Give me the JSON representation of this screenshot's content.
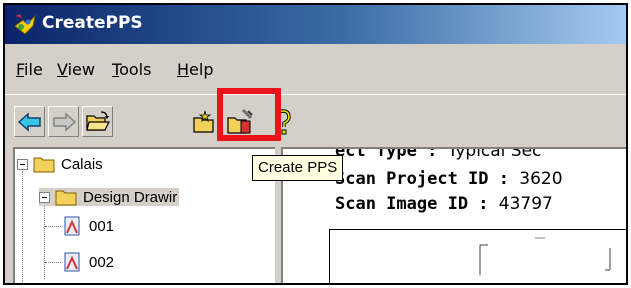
{
  "window": {
    "title": "CreatePPS"
  },
  "menu": {
    "file": {
      "mnemonic": "F",
      "rest": "ile"
    },
    "view": {
      "mnemonic": "V",
      "rest": "iew"
    },
    "tools": {
      "mnemonic": "T",
      "rest": "ools"
    },
    "help": {
      "mnemonic": "H",
      "rest": "elp"
    }
  },
  "toolbar": {
    "buttons": [
      {
        "icon": "back-arrow-icon"
      },
      {
        "icon": "forward-arrow-icon"
      },
      {
        "icon": "open-folder-icon"
      },
      {
        "icon": "new-folder-icon"
      },
      {
        "icon": "create-pps-icon"
      },
      {
        "icon": "help-icon"
      }
    ],
    "tooltip": "Create PPS"
  },
  "tree": {
    "root": "Calais",
    "folder": "Design Drawir",
    "items": [
      "001",
      "002"
    ]
  },
  "details": {
    "line1_label": "ect Type :",
    "line1_value": "Typical Sec",
    "line2_label": "Scan Project ID :",
    "line2_value": "3620",
    "line3_label": "Scan Image ID :",
    "line3_value": "43797"
  },
  "colors": {
    "titlebar_start": "#0a246a",
    "titlebar_end": "#a6caf0",
    "highlight": "#e8141a",
    "tooltip_bg": "#ffffe1"
  }
}
